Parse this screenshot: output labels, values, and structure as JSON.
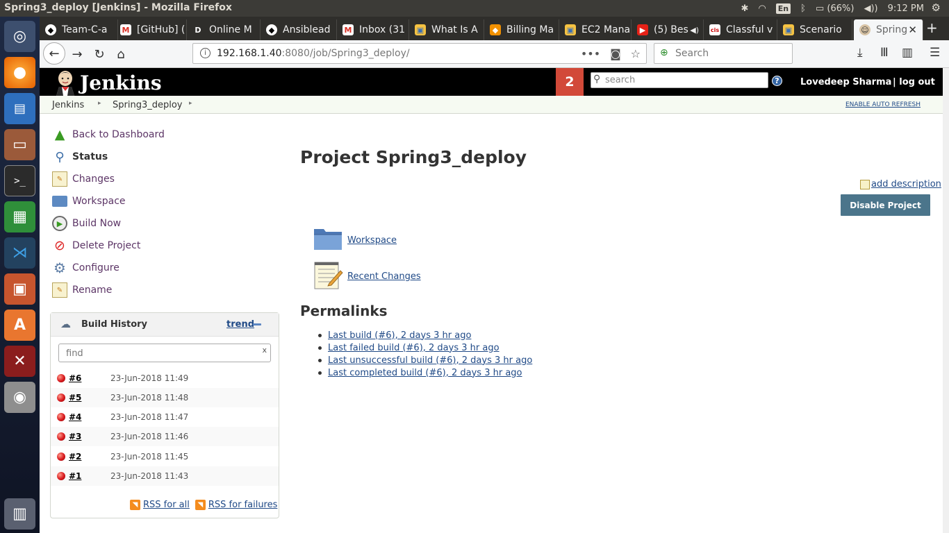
{
  "window": {
    "title": "Spring3_deploy [Jenkins] - Mozilla Firefox"
  },
  "system_tray": {
    "input_method": "En",
    "battery": "(66%)",
    "time": "9:12 PM"
  },
  "tabs": [
    {
      "label": "Team-C-a",
      "icon": "github-icon"
    },
    {
      "label": "[GitHub] (",
      "icon": "gmail-icon"
    },
    {
      "label": "Online M",
      "icon": "d-icon"
    },
    {
      "label": "Ansiblead",
      "icon": "github-icon"
    },
    {
      "label": "Inbox (31",
      "icon": "gmail-icon"
    },
    {
      "label": "What Is A",
      "icon": "cube-icon"
    },
    {
      "label": "Billing Ma",
      "icon": "aws-icon"
    },
    {
      "label": "EC2 Mana",
      "icon": "cube-icon"
    },
    {
      "label": "(5) Bes",
      "icon": "youtube-icon"
    },
    {
      "label": "Classful v",
      "icon": "cisco-icon"
    },
    {
      "label": "Scenario",
      "icon": "cube-icon"
    },
    {
      "label": "Spring",
      "icon": "jenkins-icon"
    }
  ],
  "navbar": {
    "url_host": "192.168.1.40",
    "url_rest": ":8080/job/Spring3_deploy/",
    "search_placeholder": "Search"
  },
  "jenkins": {
    "logo_text": "Jenkins",
    "notification_count": "2",
    "search_placeholder": "search",
    "help": "?",
    "user": "Lovedeep Sharma",
    "logout": "| log out",
    "breadcrumbs": [
      "Jenkins",
      "Spring3_deploy"
    ],
    "auto_refresh": "ENABLE AUTO REFRESH",
    "tasks": [
      {
        "label": "Back to Dashboard",
        "icon": "arrow-up-icon"
      },
      {
        "label": "Status",
        "icon": "magnifier-icon"
      },
      {
        "label": "Changes",
        "icon": "notepad-icon"
      },
      {
        "label": "Workspace",
        "icon": "folder-icon"
      },
      {
        "label": "Build Now",
        "icon": "clock-icon"
      },
      {
        "label": "Delete Project",
        "icon": "no-entry-icon"
      },
      {
        "label": "Configure",
        "icon": "gear-icon"
      },
      {
        "label": "Rename",
        "icon": "notepad-icon"
      }
    ],
    "build_history": {
      "title": "Build History",
      "trend": "trend",
      "find_placeholder": "find",
      "clear": "x",
      "builds": [
        {
          "number": "#6",
          "date": "23-Jun-2018 11:49",
          "status": "failed"
        },
        {
          "number": "#5",
          "date": "23-Jun-2018 11:48",
          "status": "failed"
        },
        {
          "number": "#4",
          "date": "23-Jun-2018 11:47",
          "status": "failed"
        },
        {
          "number": "#3",
          "date": "23-Jun-2018 11:46",
          "status": "failed"
        },
        {
          "number": "#2",
          "date": "23-Jun-2018 11:45",
          "status": "failed"
        },
        {
          "number": "#1",
          "date": "23-Jun-2018 11:43",
          "status": "failed"
        }
      ],
      "rss_all": "RSS for all",
      "rss_failures": "RSS for failures"
    },
    "main": {
      "title": "Project Spring3_deploy",
      "add_description": "add description",
      "disable_button": "Disable Project",
      "workspace_link": "Workspace",
      "recent_changes_link": "Recent Changes",
      "permalinks_title": "Permalinks",
      "permalinks": [
        "Last build (#6), 2 days 3 hr ago",
        "Last failed build (#6), 2 days 3 hr ago",
        "Last unsuccessful build (#6), 2 days 3 hr ago",
        "Last completed build (#6), 2 days 3 hr ago"
      ]
    }
  },
  "colors": {
    "jenkins_header": "#000000",
    "badge": "#d24939",
    "link": "#204a87",
    "task_link": "#5c3566",
    "disable_button": "#4b758b",
    "failed_ball": "#d8181d"
  }
}
